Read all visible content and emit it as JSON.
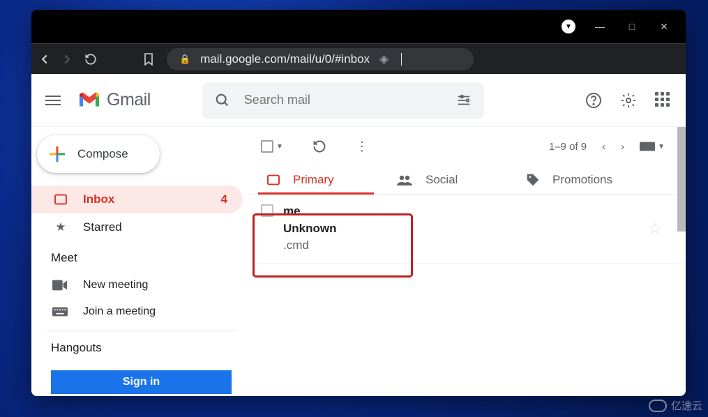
{
  "titlebar": {
    "min": "—",
    "max": "□",
    "close": "✕"
  },
  "url": "mail.google.com/mail/u/0/#inbox",
  "brand": "Gmail",
  "search": {
    "placeholder": "Search mail"
  },
  "compose": "Compose",
  "sidebar": {
    "items": [
      {
        "label": "Inbox",
        "count": "4",
        "active": true
      },
      {
        "label": "Starred"
      }
    ]
  },
  "meet": {
    "title": "Meet",
    "new": "New meeting",
    "join": "Join a meeting"
  },
  "hangouts": {
    "title": "Hangouts",
    "signin": "Sign in"
  },
  "toolbar": {
    "paging": "1–9 of 9"
  },
  "tabs": {
    "primary": "Primary",
    "social": "Social",
    "promotions": "Promotions"
  },
  "email": {
    "from": "me",
    "subject": "Unknown",
    "file": ".cmd"
  },
  "watermark": "亿速云"
}
